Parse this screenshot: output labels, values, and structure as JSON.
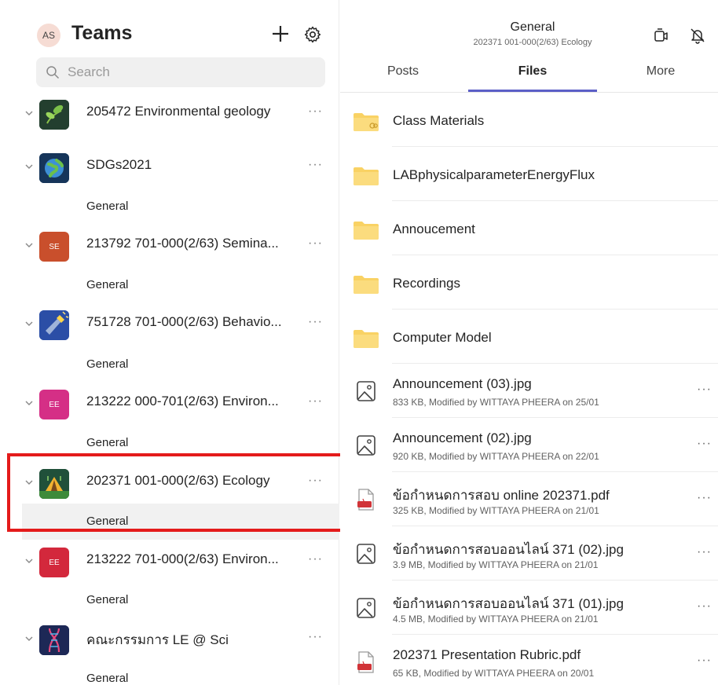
{
  "left": {
    "avatar_initials": "AS",
    "title": "Teams",
    "search_placeholder": "Search",
    "teams": [
      {
        "name": "205472 Environmental geology",
        "badge": "",
        "channel": ""
      },
      {
        "name": "SDGs2021",
        "badge": "",
        "channel": "General"
      },
      {
        "name": "213792 701-000(2/63) Semina...",
        "badge": "SE",
        "channel": "General"
      },
      {
        "name": "751728 701-000(2/63) Behavio...",
        "badge": "",
        "channel": "General"
      },
      {
        "name": "213222 000-701(2/63) Environ...",
        "badge": "EE",
        "channel": "General"
      },
      {
        "name": "202371 001-000(2/63) Ecology",
        "badge": "",
        "channel": "General"
      },
      {
        "name": "213222 701-000(2/63) Environ...",
        "badge": "EE",
        "channel": "General"
      },
      {
        "name": "คณะกรรมการ LE @ Sci",
        "badge": "",
        "channel": "General"
      }
    ],
    "more_glyph": "···"
  },
  "right": {
    "title": "General",
    "subtitle": "202371 001-000(2/63) Ecology",
    "tabs": [
      "Posts",
      "Files",
      "More"
    ],
    "folders": [
      "Class Materials",
      "LABphysicalparameterEnergyFlux",
      "Annoucement",
      "Recordings",
      "Computer Model"
    ],
    "files": [
      {
        "name": "Announcement (03).jpg",
        "meta": "833 KB, Modified by WITTAYA PHEERA on 25/01",
        "kind": "image"
      },
      {
        "name": "Announcement (02).jpg",
        "meta": "920 KB, Modified by WITTAYA PHEERA on 22/01",
        "kind": "image"
      },
      {
        "name": "ข้อกำหนดการสอบ online 202371.pdf",
        "meta": "325 KB, Modified by WITTAYA PHEERA on 21/01",
        "kind": "pdf"
      },
      {
        "name": "ข้อกำหนดการสอบออนไลน์ 371 (02).jpg",
        "meta": "3.9 MB, Modified by WITTAYA PHEERA on 21/01",
        "kind": "image"
      },
      {
        "name": "ข้อกำหนดการสอบออนไลน์ 371 (01).jpg",
        "meta": "4.5 MB, Modified by WITTAYA PHEERA on 21/01",
        "kind": "image"
      },
      {
        "name": "202371 Presentation Rubric.pdf",
        "meta": "65 KB, Modified by WITTAYA PHEERA on 20/01",
        "kind": "pdf"
      }
    ],
    "more_glyph": "···"
  },
  "colors": {
    "accent": "#5b5fc7",
    "highlight": "#e41b1b",
    "folder": "#f9d264"
  }
}
